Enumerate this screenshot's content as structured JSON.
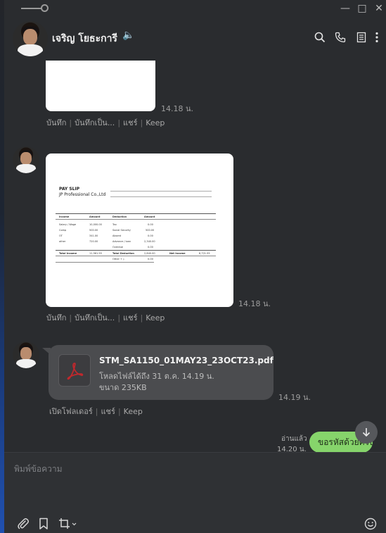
{
  "window": {
    "minimize_glyph": "—",
    "maximize_glyph": "□",
    "close_glyph": "✕"
  },
  "header": {
    "contact_name": "เจริญ โยธะการี",
    "speaker_icon": "🔈"
  },
  "messages": [
    {
      "type": "image",
      "time": "14.18 น.",
      "actions": [
        "บันทึก",
        "บันทึกเป็น...",
        "แชร์",
        "Keep"
      ]
    },
    {
      "type": "image",
      "time": "14.18 น.",
      "actions": [
        "บันทึก",
        "บันทึกเป็น...",
        "แชร์",
        "Keep"
      ],
      "payslip": {
        "title_line1": "PAY SLIP",
        "title_line2": "JP Professional Co.,Ltd",
        "cols": [
          "Income",
          "Amount",
          "Deduction",
          "Amount"
        ],
        "income_rows": [
          [
            "Salary / Wage",
            "10,000.00"
          ],
          [
            "Comp",
            "500.00"
          ],
          [
            "OT",
            "341.00"
          ],
          [
            "other",
            "720.00"
          ]
        ],
        "deduction_rows": [
          [
            "Tax",
            "0.00"
          ],
          [
            "Social Security",
            "500.00"
          ],
          [
            "Absent",
            "0.00"
          ],
          [
            "Advance / loan",
            "2,340.00"
          ],
          [
            "Overdue",
            "0.00"
          ]
        ],
        "total_income_label": "Total Income",
        "total_income": "11,561.55",
        "total_deduction_label": "Total Deduction",
        "total_deduction": "2,840.00",
        "net_income_label": "Net Income",
        "net_income": "8,721.55",
        "other_label": "Other + /-",
        "other_value": "0.00"
      }
    },
    {
      "type": "file",
      "time": "14.19 น.",
      "file_name": "STM_SA1150_01MAY23_23OCT23.pdf",
      "expire_text": "โหลดไฟล์ได้ถึง 31 ต.ค. 14.19 น.",
      "size_text": "ขนาด 235KB",
      "actions": [
        "เปิดโฟลเดอร์",
        "แชร์",
        "Keep"
      ]
    },
    {
      "type": "sent",
      "text": "ขอรหัสด้วยครับ",
      "read_label": "อ่านแล้ว",
      "time": "14.20 น."
    }
  ],
  "composer": {
    "placeholder": "พิมพ์ข้อความ"
  },
  "colors": {
    "background": "#2a2c2f",
    "sent_bubble": "#86d46b",
    "file_bubble": "#4b4c4f",
    "pdf_red": "#c0282d"
  }
}
